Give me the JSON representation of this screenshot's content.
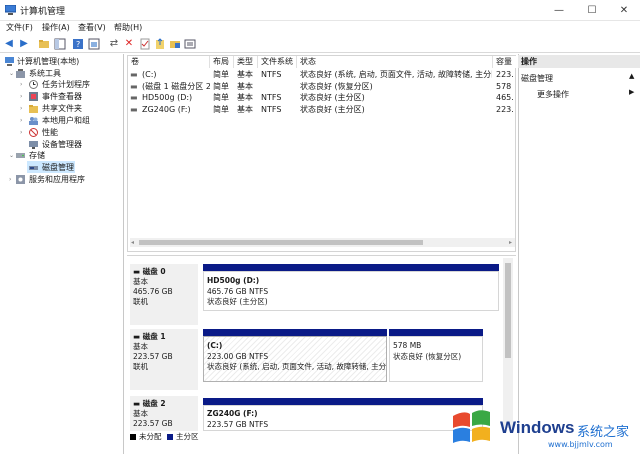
{
  "window": {
    "title": "计算机管理",
    "minimize": "—",
    "maximize": "☐",
    "close": "✕"
  },
  "menu": [
    "文件(F)",
    "操作(A)",
    "查看(V)",
    "帮助(H)"
  ],
  "tree": {
    "root": "计算机管理(本地)",
    "system_tools": "系统工具",
    "task_scheduler": "任务计划程序",
    "event_viewer": "事件查看器",
    "shared_folders": "共享文件夹",
    "local_users": "本地用户和组",
    "performance": "性能",
    "device_manager": "设备管理器",
    "storage": "存储",
    "disk_management": "磁盘管理",
    "services": "服务和应用程序"
  },
  "volume_table": {
    "headers": [
      "卷",
      "布局",
      "类型",
      "文件系统",
      "状态",
      "容量"
    ],
    "rows": [
      [
        "(C:)",
        "简单",
        "基本",
        "NTFS",
        "状态良好 (系统, 启动, 页面文件, 活动, 故障转储, 主分区)",
        "223."
      ],
      [
        "(磁盘 1 磁盘分区 2)",
        "简单",
        "基本",
        "",
        "状态良好 (恢复分区)",
        "578"
      ],
      [
        "HD500g (D:)",
        "简单",
        "基本",
        "NTFS",
        "状态良好 (主分区)",
        "465."
      ],
      [
        "ZG240G (F:)",
        "简单",
        "基本",
        "NTFS",
        "状态良好 (主分区)",
        "223."
      ]
    ]
  },
  "disks": [
    {
      "name": "磁盘 0",
      "type": "基本",
      "size": "465.76 GB",
      "status": "联机",
      "partitions": [
        {
          "name": "HD500g  (D:)",
          "size": "465.76 GB NTFS",
          "status": "状态良好 (主分区)"
        }
      ]
    },
    {
      "name": "磁盘 1",
      "type": "基本",
      "size": "223.57 GB",
      "status": "联机",
      "partitions": [
        {
          "name": "(C:)",
          "size": "223.00 GB NTFS",
          "status": "状态良好 (系统, 启动, 页面文件, 活动, 故障转储, 主分"
        },
        {
          "name": "",
          "size": "578 MB",
          "status": "状态良好 (恢复分区)"
        }
      ]
    },
    {
      "name": "磁盘 2",
      "type": "基本",
      "size": "223.57 GB",
      "status": "",
      "partitions": [
        {
          "name": "ZG240G  (F:)",
          "size": "223.57 GB NTFS",
          "status": ""
        }
      ]
    }
  ],
  "legend": {
    "unallocated": "未分配",
    "primary": "主分区"
  },
  "actions": {
    "header": "操作",
    "section": "磁盘管理",
    "more": "更多操作"
  },
  "watermark": {
    "brand": "Windows",
    "cn": "系统之家",
    "url": "www.bjjmlv.com"
  },
  "colors": {
    "partition_bar": "#0a1a87",
    "selected_row": "#cce8ff",
    "accent": "#1e6fd0"
  }
}
